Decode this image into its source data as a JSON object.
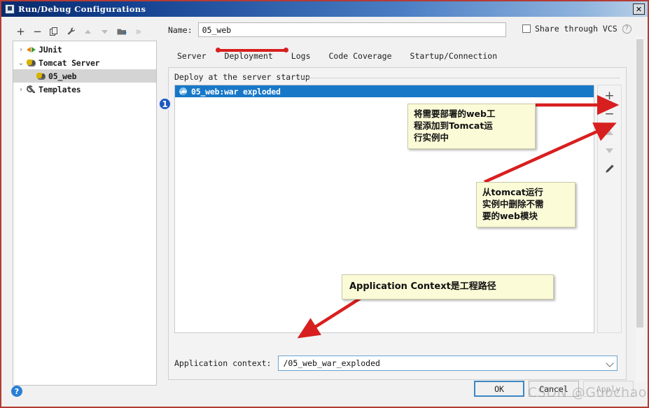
{
  "window": {
    "title": "Run/Debug Configurations",
    "close_label": "✕",
    "icon": "idea-window-icon"
  },
  "left_toolbar": {
    "buttons": [
      {
        "name": "add-configuration-button",
        "glyph": "+",
        "dim": false
      },
      {
        "name": "remove-configuration-button",
        "glyph": "−",
        "dim": false
      },
      {
        "name": "copy-configuration-button",
        "glyph": "❐",
        "dim": false
      },
      {
        "name": "edit-templates-button",
        "glyph": "🔧",
        "dim": false
      },
      {
        "name": "move-up-button",
        "glyph": "▲",
        "dim": true
      },
      {
        "name": "move-down-button",
        "glyph": "▼",
        "dim": true
      },
      {
        "name": "move-into-folder-button",
        "glyph": "▤",
        "dim": false
      },
      {
        "name": "more-options-button",
        "glyph": "»",
        "dim": true
      }
    ]
  },
  "tree": {
    "items": [
      {
        "label": "JUnit",
        "twisty": "›",
        "icon": "junit-icon",
        "indent": 0,
        "selected": false
      },
      {
        "label": "Tomcat Server",
        "twisty": "⌄",
        "icon": "tomcat-icon",
        "indent": 0,
        "selected": false
      },
      {
        "label": "05_web",
        "twisty": "",
        "icon": "tomcat-icon",
        "indent": 1,
        "selected": true
      },
      {
        "label": "Templates",
        "twisty": "›",
        "icon": "wrench-icon",
        "indent": 0,
        "selected": false
      }
    ]
  },
  "name_field": {
    "label": "Name:",
    "value": "05_web",
    "placeholder": ""
  },
  "share": {
    "label": "Share through VCS",
    "checked": false,
    "help_glyph": "?"
  },
  "tabs": [
    {
      "label": "Server",
      "active": false
    },
    {
      "label": "Deployment",
      "active": true
    },
    {
      "label": "Logs",
      "active": false
    },
    {
      "label": "Code Coverage",
      "active": false
    },
    {
      "label": "Startup/Connection",
      "active": false
    }
  ],
  "deployment_panel": {
    "legend": "Deploy at the server startup",
    "artifacts": [
      {
        "label": "05_web:war exploded",
        "icon": "artifact-icon",
        "selected": true
      }
    ],
    "side_buttons": [
      {
        "name": "add-artifact-button",
        "glyph": "+",
        "dim": false
      },
      {
        "name": "remove-artifact-button",
        "glyph": "−",
        "dim": false
      },
      {
        "name": "move-artifact-up-button",
        "glyph": "▲",
        "dim": true
      },
      {
        "name": "move-artifact-down-button",
        "glyph": "▼",
        "dim": true
      },
      {
        "name": "edit-artifact-button",
        "glyph": "✎",
        "dim": false
      }
    ],
    "application_context": {
      "label": "Application context:",
      "value": "/05_web_war_exploded",
      "placeholder": ""
    }
  },
  "badges": {
    "step_one": "1"
  },
  "annotations": [
    {
      "id": "note1",
      "text": "将需要部署的web工\n程添加到Tomcat运\n行实例中"
    },
    {
      "id": "note2",
      "text": "从tomcat运行\n实例中删除不需\n要的web模块"
    },
    {
      "id": "note3",
      "text": "Application Context是工程路径"
    }
  ],
  "footer": {
    "help_glyph": "?",
    "buttons": [
      {
        "label": "OK",
        "style": "primary",
        "disabled": false
      },
      {
        "label": "Cancel",
        "style": "normal",
        "disabled": false
      },
      {
        "label": "Apply",
        "style": "normal",
        "disabled": true
      }
    ]
  },
  "watermark": "CSDN @GuochaoHN"
}
